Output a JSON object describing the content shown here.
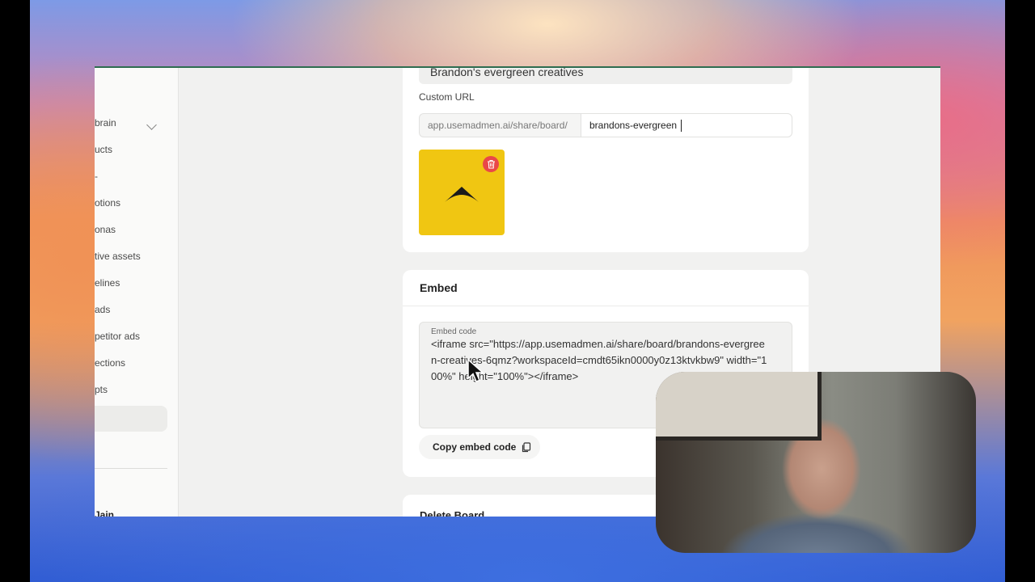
{
  "sidebar": {
    "items": [
      "brain",
      "ucts",
      "-",
      "otions",
      "onas",
      "tive assets",
      "elines",
      "ads",
      "petitor ads",
      "ections",
      "pts"
    ],
    "user": "Jain"
  },
  "board": {
    "name_value": "Brandon's evergreen creatives",
    "custom_url_label": "Custom URL",
    "url_prefix": "app.usemadmen.ai/share/board/",
    "url_slug": "brandons-evergreen"
  },
  "embed": {
    "title": "Embed",
    "code_label": "Embed code",
    "code": "<iframe src=\"https://app.usemadmen.ai/share/board/brandons-evergreen-creatives-6qmz?workspaceId=cmdt65ikn0000y0z13ktvkbw9\" width=\"100%\" height=\"100%\"></iframe>",
    "copy_label": "Copy embed code"
  },
  "delete": {
    "title": "Delete Board"
  },
  "colors": {
    "logo_bg": "#f0c612",
    "trash_bg": "#e94848"
  }
}
